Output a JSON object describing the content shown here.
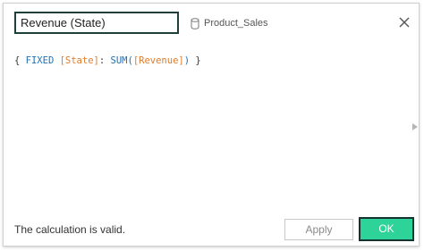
{
  "calc_name": {
    "value": "Revenue (State)"
  },
  "datasource": {
    "label": "Product_Sales",
    "icon": "database-icon"
  },
  "close": {
    "icon": "close-icon"
  },
  "formula": {
    "open_brace": "{ ",
    "fixed_kw": "FIXED",
    "space1": " ",
    "state_field": "[State]",
    "colon": ": ",
    "sum_fn": "SUM(",
    "revenue_field": "[Revenue]",
    "close_paren": ")",
    "close_brace": " }"
  },
  "expand": {
    "icon": "expand-right-arrow-icon"
  },
  "status": {
    "text": "The calculation is valid."
  },
  "buttons": {
    "apply_label": "Apply",
    "ok_label": "OK"
  },
  "colors": {
    "keyword": "#1f6fb5",
    "field": "#e07b2a",
    "ok_bg": "#2ed39a",
    "ok_border": "#14342f"
  }
}
